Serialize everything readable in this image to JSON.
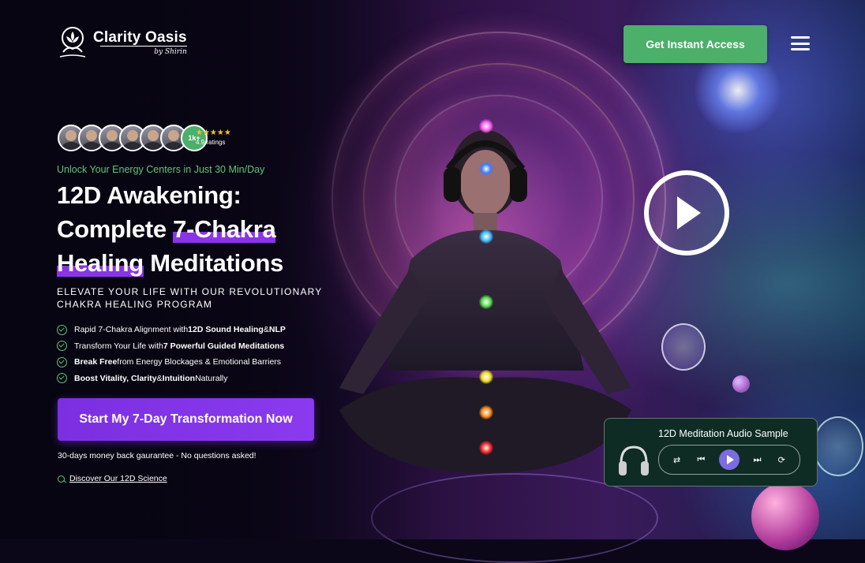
{
  "brand": {
    "name": "Clarity Oasis",
    "byline": "by Shirin"
  },
  "header": {
    "cta_label": "Get Instant Access",
    "menu_icon": "hamburger-menu-icon"
  },
  "social_proof": {
    "count_label": "1k+",
    "stars": "★★★★★",
    "rating_text": "4.9 ratings"
  },
  "hero": {
    "tagline": "Unlock Your Energy Centers in Just 30 Min/Day",
    "headline_line1": "12D Awakening:",
    "headline_part2a": "Complete ",
    "headline_highlight1": "7-Chakra",
    "headline_highlight2": "Healing",
    "headline_part3": " Meditations",
    "subheadline": "ELEVATE YOUR LIFE WITH OUR REVOLUTIONARY CHAKRA HEALING PROGRAM",
    "features": [
      {
        "pre": "Rapid 7-Chakra Alignment with ",
        "bold1": "12D Sound Healing",
        "mid": " & ",
        "bold2": "NLP",
        "post": ""
      },
      {
        "pre": "Transform Your Life with ",
        "bold1": "7 Powerful Guided Meditations",
        "mid": "",
        "bold2": "",
        "post": ""
      },
      {
        "pre": "",
        "bold1": "Break Free",
        "mid": " from Energy Blockages & Emotional Barriers",
        "bold2": "",
        "post": ""
      },
      {
        "pre": "",
        "bold1": "Boost Vitality, Clarity",
        "mid": " & ",
        "bold2": "Intuition",
        "post": " Naturally"
      }
    ],
    "cta_label": "Start My 7-Day Transformation Now",
    "guarantee": "30-days money back gaurantee - No questions asked!",
    "science_link": "Discover Our 12D Science"
  },
  "player": {
    "title": "12D Meditation Audio Sample",
    "icons": [
      "headphones-icon",
      "shuffle-icon",
      "previous-icon",
      "play-icon",
      "next-icon",
      "repeat-icon"
    ]
  },
  "colors": {
    "green": "#4caf6a",
    "purple": "#7b2fe0",
    "tagline_green": "#5fc67b",
    "player_bg": "#0e2c24"
  }
}
